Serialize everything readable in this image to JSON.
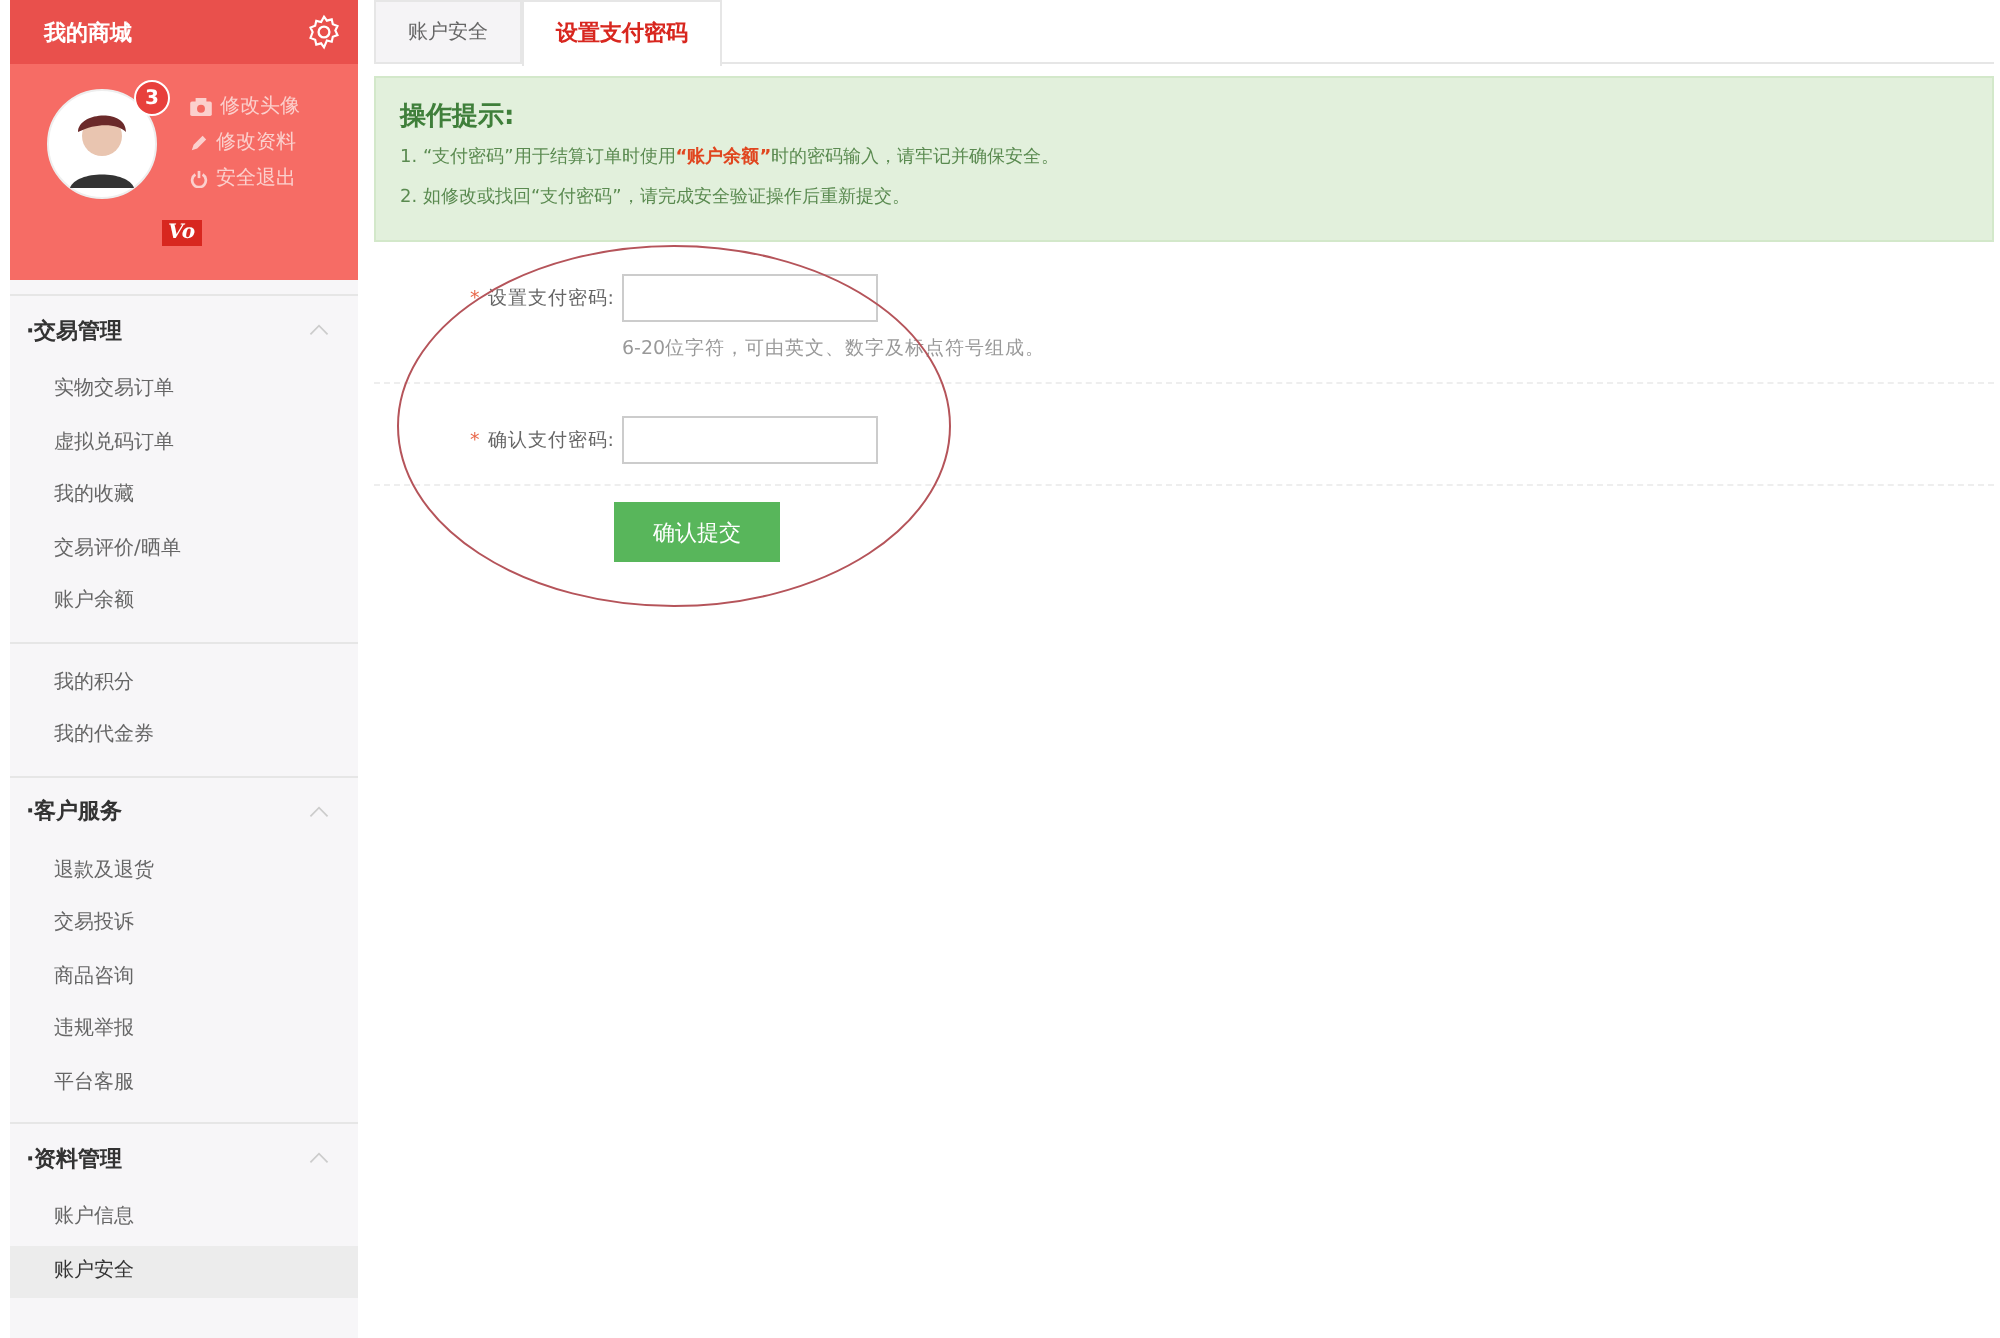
{
  "sidebar": {
    "title": "我的商城",
    "profile": {
      "badge": "3",
      "actions": [
        "修改头像",
        "修改资料",
        "安全退出"
      ],
      "level_badge": "Vo"
    },
    "groups": [
      {
        "title": "·交易管理",
        "expanded": true,
        "sections": [
          [
            {
              "label": "实物交易订单",
              "selected": false
            },
            {
              "label": "虚拟兑码订单",
              "selected": false
            },
            {
              "label": "我的收藏",
              "selected": false
            },
            {
              "label": "交易评价/晒单",
              "selected": false
            },
            {
              "label": "账户余额",
              "selected": false
            }
          ],
          [
            {
              "label": "我的积分",
              "selected": false
            },
            {
              "label": "我的代金券",
              "selected": false
            }
          ]
        ]
      },
      {
        "title": "·客户服务",
        "expanded": true,
        "sections": [
          [
            {
              "label": "退款及退货",
              "selected": false
            },
            {
              "label": "交易投诉",
              "selected": false
            },
            {
              "label": "商品咨询",
              "selected": false
            },
            {
              "label": "违规举报",
              "selected": false
            },
            {
              "label": "平台客服",
              "selected": false
            }
          ]
        ]
      },
      {
        "title": "·资料管理",
        "expanded": true,
        "sections": [
          [
            {
              "label": "账户信息",
              "selected": false
            },
            {
              "label": "账户安全",
              "selected": true
            }
          ]
        ]
      }
    ]
  },
  "tabs": [
    {
      "label": "账户安全",
      "selected": false
    },
    {
      "label": "设置支付密码",
      "selected": true
    }
  ],
  "tips": {
    "title": "操作提示:",
    "lines": [
      "1. “支付密码”用于结算订单时使用**“账户余额”**时的密码输入，请牢记并确保安全。",
      "2. 如修改或找回“支付密码”，请完成安全验证操作后重新提交。"
    ]
  },
  "form": {
    "required_mark": "*",
    "fields": [
      {
        "label": "设置支付密码:",
        "required": true,
        "hint": "6-20位字符，可由英文、数字及标点符号组成。"
      },
      {
        "label": "确认支付密码:",
        "required": true
      }
    ],
    "submit": "确认提交"
  }
}
